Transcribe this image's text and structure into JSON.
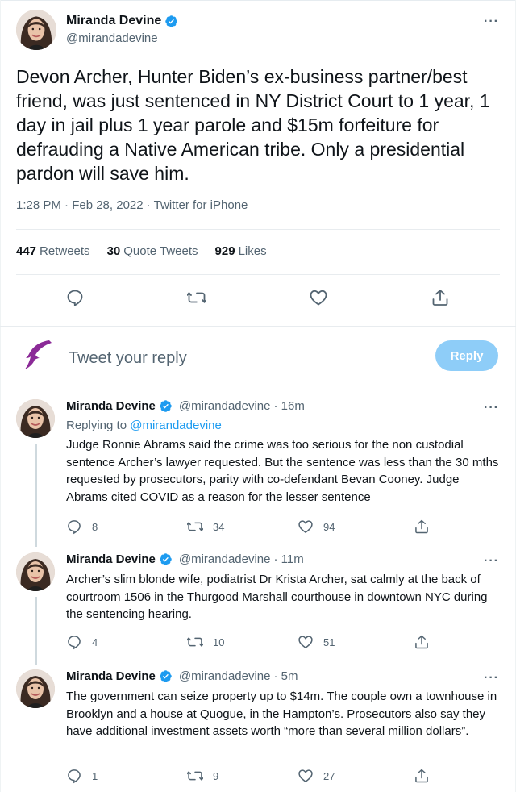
{
  "main_tweet": {
    "author_name": "Miranda Devine",
    "author_handle": "@mirandadevine",
    "text": "Devon Archer, Hunter Biden’s ex-business partner/best friend, was just sentenced in NY District Court to 1 year, 1 day in jail plus 1 year parole and $15m forfeiture for defrauding a Native American tribe. Only a presidential pardon will save him.",
    "meta": "1:28 PM · Feb 28, 2022 · Twitter for iPhone",
    "stats": {
      "retweets_count": "447",
      "retweets_label": "Retweets",
      "quotes_count": "30",
      "quotes_label": "Quote Tweets",
      "likes_count": "929",
      "likes_label": "Likes"
    },
    "more_label": "···"
  },
  "reply_composer": {
    "placeholder": "Tweet your reply",
    "button_label": "Reply"
  },
  "replies": [
    {
      "author_name": "Miranda Devine",
      "author_handle": "@mirandadevine",
      "time": "· 16m",
      "replying_prefix": "Replying to",
      "replying_to": "@mirandadevine",
      "text": "Judge Ronnie Abrams said the crime was too serious for the non custodial sentence Archer’s lawyer requested. But the sentence was less than the 30 mths requested by prosecutors, parity with co-defendant Bevan Cooney. Judge Abrams cited COVID as a reason for the lesser sentence",
      "reply_count": "8",
      "retweet_count": "34",
      "like_count": "94"
    },
    {
      "author_name": "Miranda Devine",
      "author_handle": "@mirandadevine",
      "time": "· 11m",
      "text": "Archer’s slim blonde wife, podiatrist Dr Krista Archer, sat calmly at the back of courtroom 1506 in the Thurgood Marshall courthouse in downtown NYC during the sentencing hearing.",
      "reply_count": "4",
      "retweet_count": "10",
      "like_count": "51"
    },
    {
      "author_name": "Miranda Devine",
      "author_handle": "@mirandadevine",
      "time": "· 5m",
      "text": "The government can seize property up to $14m. The couple own a townhouse in Brooklyn and a house at Quogue, in the Hampton’s. Prosecutors also say they have additional investment assets worth “more than several million dollars”.",
      "reply_count": "1",
      "retweet_count": "9",
      "like_count": "27"
    }
  ],
  "colors": {
    "accent": "#1d9bf0",
    "reply_button": "#8ecdf8",
    "secondary_text": "#536471",
    "divider": "#e8ecef",
    "logo": "#8b2a97"
  },
  "icons": {
    "verified": "verified-badge-icon",
    "reply": "reply-icon",
    "retweet": "retweet-icon",
    "like": "heart-icon",
    "share": "share-icon",
    "more": "more-icon",
    "logo": "dolphin-logo-icon"
  }
}
